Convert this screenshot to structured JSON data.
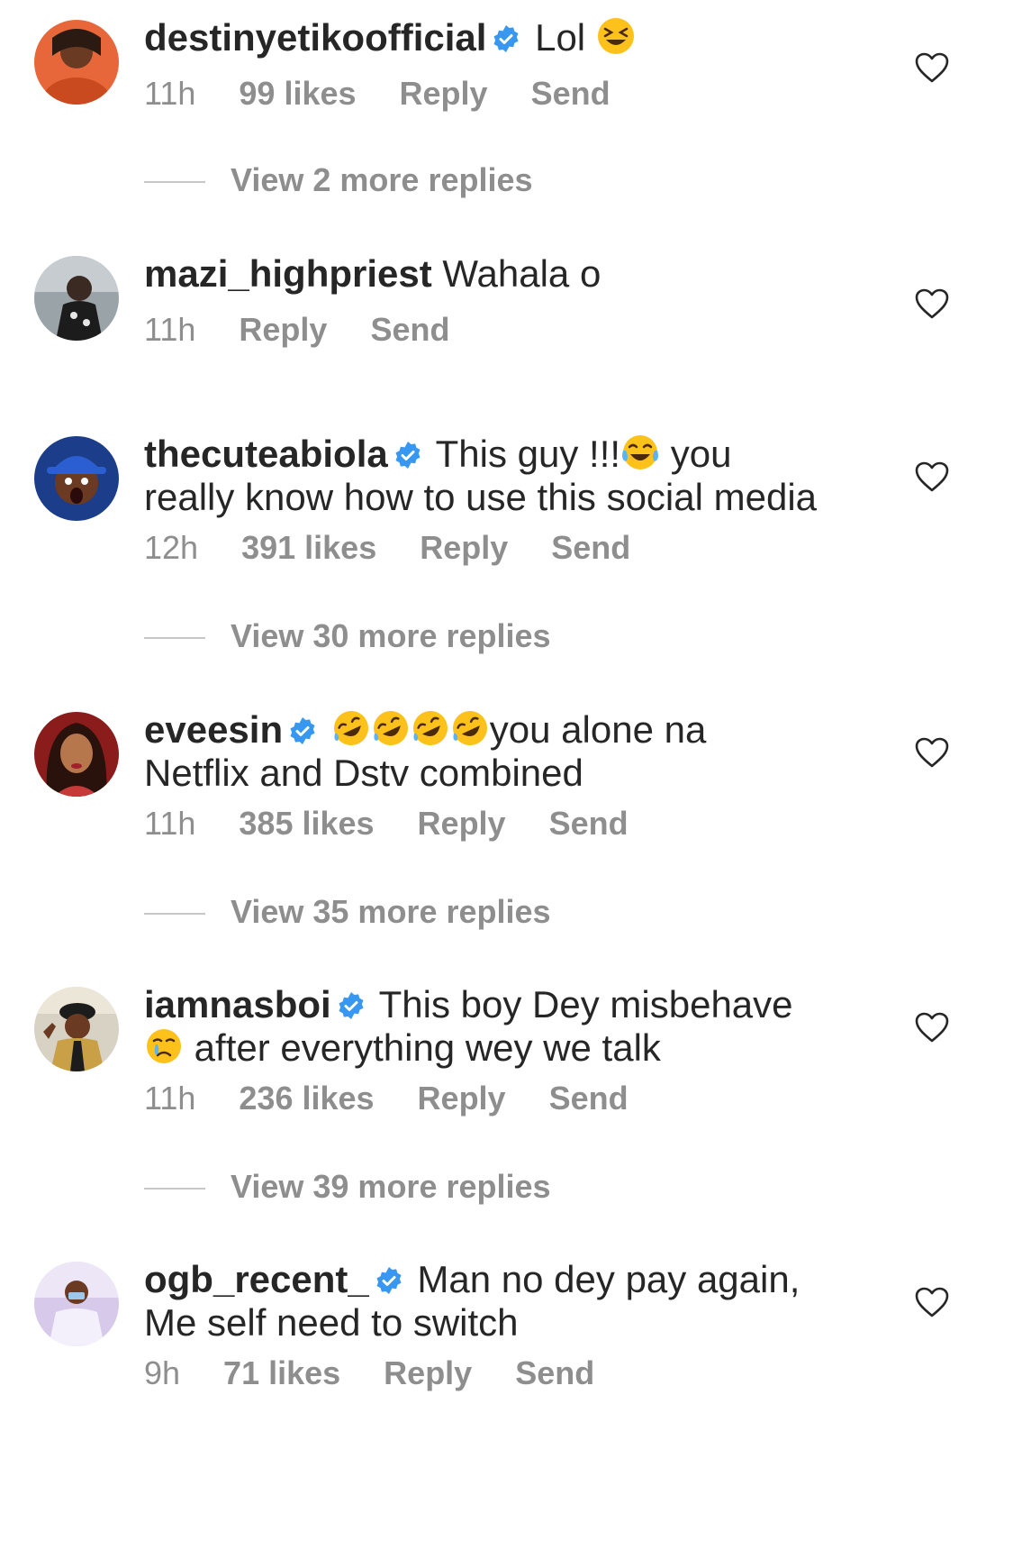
{
  "comments": [
    {
      "username": "destinyetikoofficial",
      "verified": true,
      "text": "Lol",
      "emoji_after": [
        "squinting-face"
      ],
      "time": "11h",
      "likes": "99 likes",
      "reply": "Reply",
      "send": "Send",
      "view_replies": "View 2 more replies"
    },
    {
      "username": "mazi_highpriest",
      "verified": false,
      "text": "Wahala o",
      "time": "11h",
      "likes": "",
      "reply": "Reply",
      "send": "Send",
      "view_replies": ""
    },
    {
      "username": "thecuteabiola",
      "verified": true,
      "text_before": "This guy !!!",
      "text_after": " you",
      "text_line2": "really know how to use this social media",
      "time": "12h",
      "likes": "391 likes",
      "reply": "Reply",
      "send": "Send",
      "view_replies": "View 30 more replies"
    },
    {
      "username": "eveesin",
      "verified": true,
      "text_after": "you alone na",
      "text_line2": "Netflix and Dstv combined",
      "time": "11h",
      "likes": "385 likes",
      "reply": "Reply",
      "send": "Send",
      "view_replies": "View 35 more replies"
    },
    {
      "username": "iamnasboi",
      "verified": true,
      "text": "This boy Dey misbehave",
      "text_line2": " after everything wey we talk",
      "time": "11h",
      "likes": "236 likes",
      "reply": "Reply",
      "send": "Send",
      "view_replies": "View 39 more replies"
    },
    {
      "username": "ogb_recent_",
      "verified": true,
      "text": "Man no dey pay again,",
      "text_line2": "Me self need to switch",
      "time": "9h",
      "likes": "71 likes",
      "reply": "Reply",
      "send": "Send",
      "view_replies": ""
    }
  ],
  "icons": {
    "verified": "verified-badge-icon",
    "heart": "heart-outline-icon"
  },
  "colors": {
    "text": "#262626",
    "secondary": "#8e8e8e",
    "verified": "#3897f0"
  }
}
